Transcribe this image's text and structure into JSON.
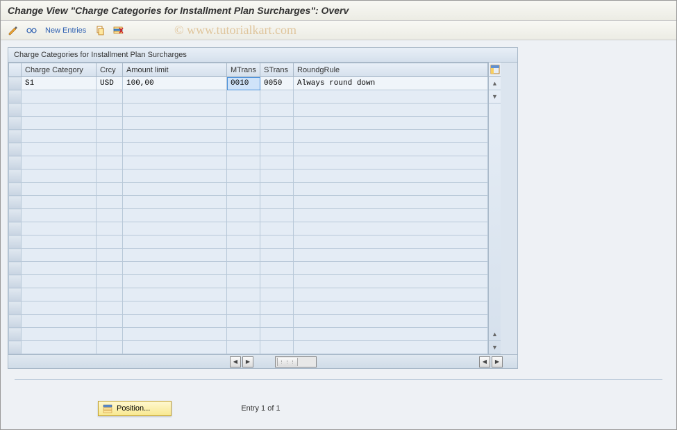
{
  "title": "Change View \"Charge Categories for Installment Plan Surcharges\": Overv",
  "watermark": "© www.tutorialkart.com",
  "toolbar": {
    "new_entries_label": "New Entries"
  },
  "grid": {
    "title": "Charge Categories for Installment Plan Surcharges",
    "columns": {
      "charge_category": "Charge Category",
      "crcy": "Crcy",
      "amount_limit": "Amount limit",
      "mtrans": "MTrans",
      "strans": "STrans",
      "roundg_rule": "RoundgRule"
    },
    "rows": [
      {
        "charge_category": "S1",
        "crcy": "USD",
        "amount_limit": "100,00",
        "mtrans": "0010",
        "strans": "0050",
        "roundg_rule": "Always round down"
      }
    ],
    "empty_rows": 20
  },
  "footer": {
    "position_label": "Position...",
    "entry_text": "Entry 1 of 1"
  }
}
